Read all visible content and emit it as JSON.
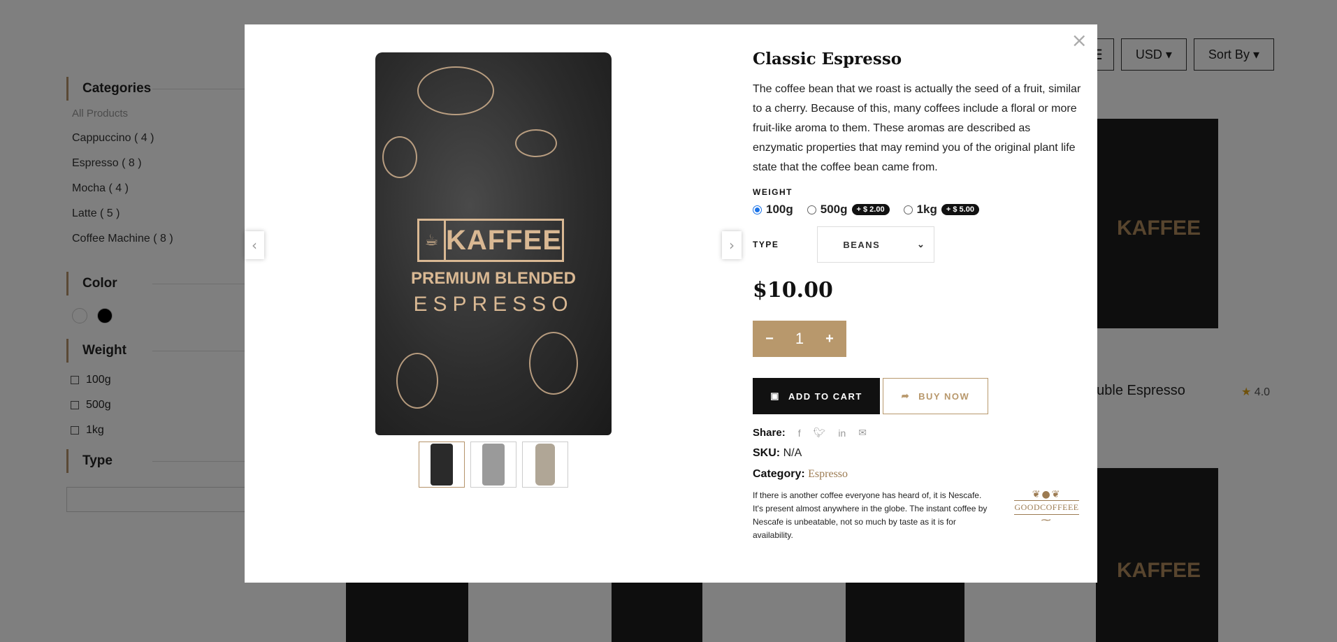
{
  "background": {
    "sidebar": {
      "categories_title": "Categories",
      "categories": [
        "All Products",
        "Cappuccino ( 4 )",
        "Espresso ( 8 )",
        "Mocha ( 4 )",
        "Latte ( 5 )",
        "Coffee Machine ( 8 )"
      ],
      "color_title": "Color",
      "weight_title": "Weight",
      "weights": [
        "100g",
        "500g",
        "1kg"
      ],
      "type_title": "Type"
    },
    "toolbar": {
      "grid_icon": "list-icon",
      "currency": "USD",
      "sort": "Sort By"
    },
    "product_partial_name": "ouble Espresso",
    "product_rating": "4.0"
  },
  "modal": {
    "close": "×",
    "product": {
      "title": "Classic Espresso",
      "description": "The coffee bean that we roast is actually the seed of a fruit, similar to a cherry. Because of this, many coffees include a floral or more fruit-like aroma to them. These aromas are described as enzymatic properties that may remind you of the original plant life state that the coffee bean came from.",
      "weight_label": "WEIGHT",
      "weight_options": [
        {
          "label": "100g",
          "extra": "",
          "selected": true
        },
        {
          "label": "500g",
          "extra": "+ $ 2.00",
          "selected": false
        },
        {
          "label": "1kg",
          "extra": "+ $ 5.00",
          "selected": false
        }
      ],
      "type_label": "TYPE",
      "type_selected": "BEANS",
      "price": "$10.00",
      "quantity": "1",
      "qty_minus": "−",
      "qty_plus": "+",
      "add_to_cart": "ADD TO CART",
      "buy_now": "BUY NOW",
      "share_label": "Share:",
      "share_icons": [
        "facebook-icon",
        "twitter-icon",
        "linkedin-icon",
        "email-icon"
      ],
      "sku_label": "SKU:",
      "sku_value": "N/A",
      "category_label": "Category:",
      "category_value": "Espresso",
      "note": "If there is another coffee everyone has heard of, it is Nescafe. It's present almost anywhere in the globe. The instant coffee by Nescafe is unbeatable, not so much by taste as it is for availability.",
      "logo_name": "GOODCOFFEEE"
    },
    "gallery": {
      "bag_brand": "KAFFEE",
      "bag_line1": "PREMIUM BLENDED",
      "bag_line2": "ESPRESSO",
      "thumbnails": [
        "thumb-dark",
        "thumb-grey",
        "thumb-jar"
      ],
      "active_thumbnail": 0
    }
  },
  "colors": {
    "accent": "#b8986c",
    "dark": "#111111",
    "radio": "#1a73e8"
  }
}
